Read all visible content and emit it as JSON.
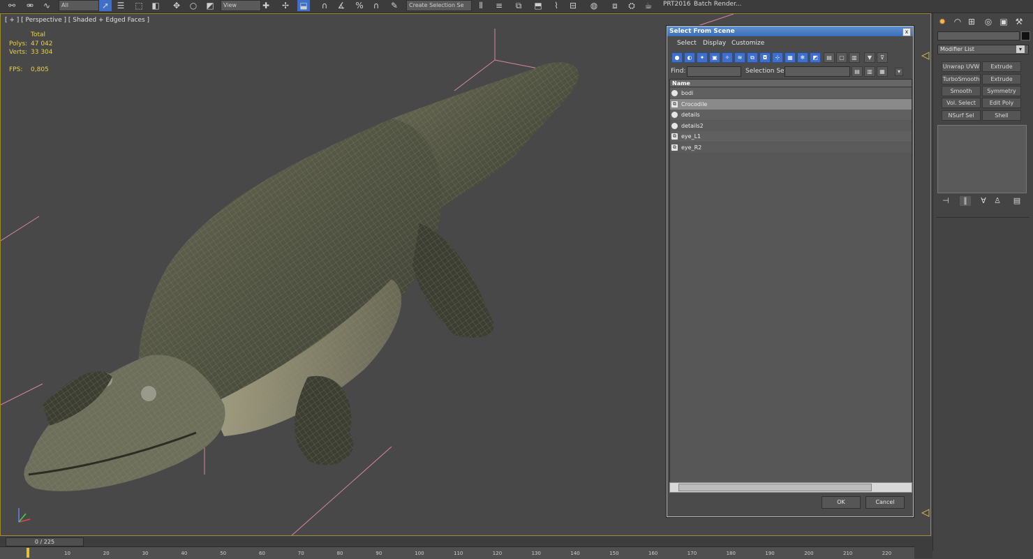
{
  "toolbar": {
    "filter_combo": "All",
    "view_combo": "View",
    "selection_set_combo": "Create Selection Se",
    "prt_label": "PRT2016",
    "batch_label": "Batch Render..."
  },
  "viewport": {
    "label": "[ + ] [ Perspective ] [ Shaded + Edged Faces ]",
    "stats": {
      "total_label": "Total",
      "polys_label": "Polys:",
      "polys_value": "47 042",
      "verts_label": "Verts:",
      "verts_value": "33 304",
      "fps_label": "FPS:",
      "fps_value": "0,805"
    }
  },
  "command_panel": {
    "modifier_list_label": "Modifier List",
    "modifier_buttons": [
      "Unwrap UVW",
      "Extrude",
      "TurboSmooth",
      "Extrude",
      "Smooth",
      "Symmetry",
      "Vol. Select",
      "Edit Poly",
      "NSurf Sel",
      "Shell"
    ]
  },
  "dialog": {
    "title": "Select From Scene",
    "close_glyph": "x",
    "menu": [
      "Select",
      "Display",
      "Customize"
    ],
    "find_label": "Find:",
    "selection_set_label": "Selection Set:",
    "column_name": "Name",
    "items": [
      {
        "name": "bodi",
        "icon": "sphere",
        "selected": false
      },
      {
        "name": "Crocodile",
        "icon": "group",
        "selected": true
      },
      {
        "name": "details",
        "icon": "sphere",
        "selected": false
      },
      {
        "name": "details2",
        "icon": "sphere",
        "selected": false
      },
      {
        "name": "eye_L1",
        "icon": "group",
        "selected": false
      },
      {
        "name": "eye_R2",
        "icon": "group",
        "selected": false
      }
    ],
    "ok_label": "OK",
    "cancel_label": "Cancel"
  },
  "timeline": {
    "frame_display": "0 / 225",
    "ticks": [
      "10",
      "20",
      "30",
      "40",
      "50",
      "60",
      "70",
      "80",
      "90",
      "100",
      "110",
      "120",
      "130",
      "140",
      "150",
      "160",
      "170",
      "180",
      "190",
      "200",
      "210",
      "220"
    ]
  },
  "colors": {
    "viewport_border": "#9c8a3a",
    "stats_text": "#e8d24a",
    "dialog_title": "#3b6fb9",
    "selection_row": "#8a8a8a"
  }
}
